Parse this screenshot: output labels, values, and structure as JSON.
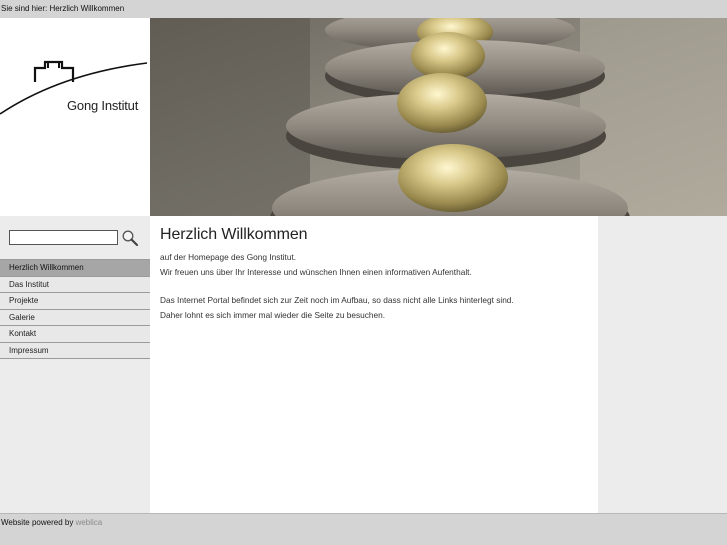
{
  "breadcrumb": {
    "label": "Sie sind hier:",
    "current": "Herzlich Willkommen"
  },
  "logo": {
    "text": "Gong Institut"
  },
  "search": {
    "value": "",
    "placeholder": ""
  },
  "nav": {
    "items": [
      {
        "label": "Herzlich Willkommen",
        "active": true
      },
      {
        "label": "Das Institut"
      },
      {
        "label": "Projekte"
      },
      {
        "label": "Galerie"
      },
      {
        "label": "Kontakt"
      },
      {
        "label": "Impressum"
      }
    ]
  },
  "main": {
    "title": "Herzlich Willkommen",
    "line1": "auf der Homepage des Gong Institut.",
    "line2": "Wir freuen uns über Ihr Interesse und wünschen Ihnen einen informativen Aufenthalt.",
    "line3": "Das Internet Portal befindet sich zur Zeit noch im Aufbau, so dass nicht alle Links hinterlegt sind.",
    "line4": "Daher lohnt es sich immer mal wieder die Seite zu besuchen."
  },
  "footer": {
    "text": "Website powered by",
    "link": "weblica"
  },
  "colors": {
    "nav_active": "#a6a6a6",
    "bar": "#d4d4d4",
    "sidebar": "#ececec"
  },
  "icons": {
    "search": "magnifier-icon"
  }
}
